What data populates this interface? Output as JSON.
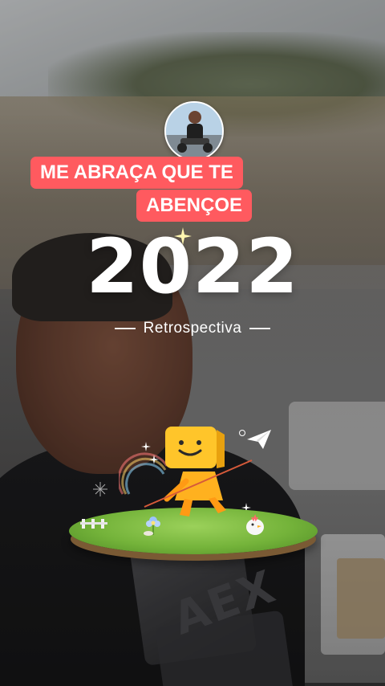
{
  "caption": {
    "line1": "ME ABRAÇA QUE TE",
    "line2": "ABENÇOE",
    "color": "#ff5a5f"
  },
  "year": "2022",
  "subtitle": "Retrospectiva",
  "background_shirt_text": "AEX",
  "icons": {
    "avatar": "profile-photo",
    "sparkle": "sparkle-icon",
    "mascot": "yellow-cube-mascot",
    "paper_plane": "paper-plane-icon",
    "bird": "chick-icon",
    "flower": "flower-icon"
  }
}
